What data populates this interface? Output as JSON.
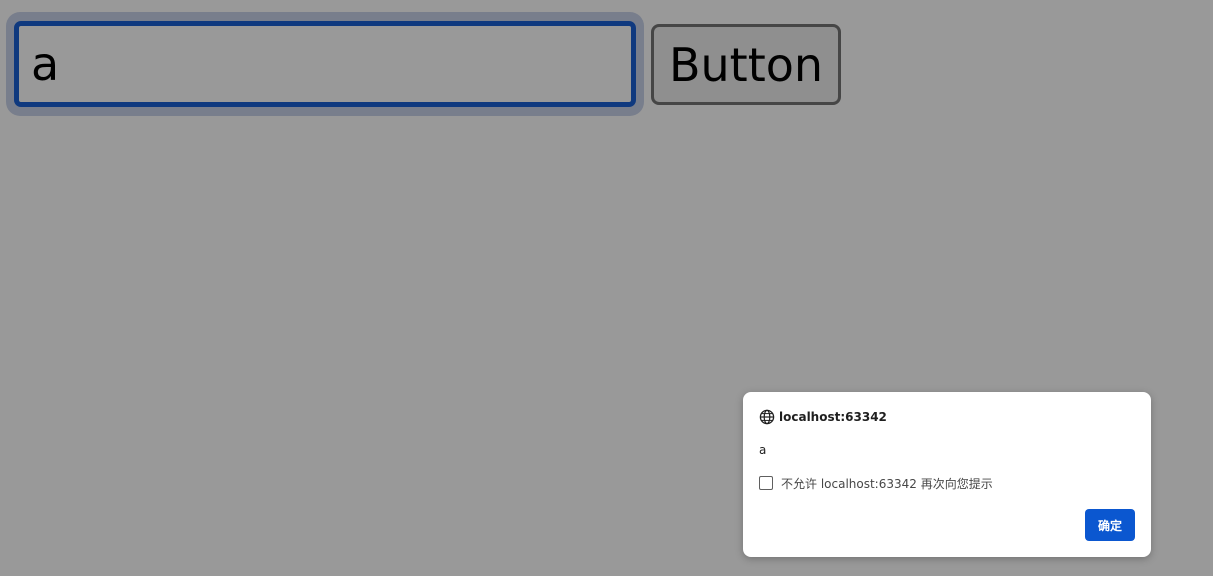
{
  "page": {
    "input_value": "a",
    "button_label": "Button"
  },
  "dialog": {
    "origin": "localhost:63342",
    "message": "a",
    "suppress_label": "不允许 localhost:63342 再次向您提示",
    "suppress_checked": false,
    "ok_label": "确定",
    "globe_icon": "globe-icon"
  },
  "colors": {
    "backdrop": "rgba(0,0,0,0.4)",
    "input_focus_border": "#1a5fd4",
    "ok_button": "#0b57d0"
  }
}
